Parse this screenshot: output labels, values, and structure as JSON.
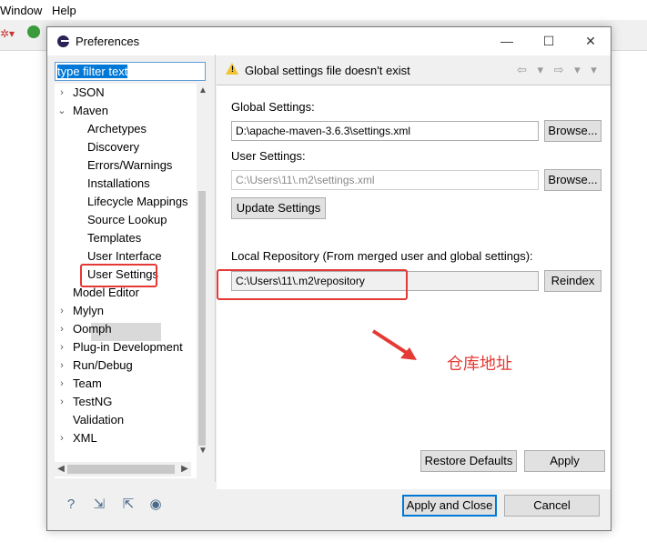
{
  "menubar": {
    "items": [
      "Window",
      "Help"
    ]
  },
  "dialog": {
    "title": "Preferences",
    "window_controls": [
      "—",
      "☐",
      "✕"
    ],
    "filter_text": "type filter text",
    "tree": [
      {
        "label": "JSON",
        "arrow": "›"
      },
      {
        "label": "Maven",
        "arrow": "⌄"
      },
      {
        "label": "Archetypes"
      },
      {
        "label": "Discovery"
      },
      {
        "label": "Errors/Warnings"
      },
      {
        "label": "Installations"
      },
      {
        "label": "Lifecycle Mappings"
      },
      {
        "label": "Source Lookup"
      },
      {
        "label": "Templates"
      },
      {
        "label": "User Interface"
      },
      {
        "label": "User Settings"
      },
      {
        "label": "Model Editor"
      },
      {
        "label": "Mylyn",
        "arrow": "›"
      },
      {
        "label": "Oomph",
        "arrow": "›"
      },
      {
        "label": "Plug-in Development",
        "arrow": "›"
      },
      {
        "label": "Run/Debug",
        "arrow": "›"
      },
      {
        "label": "Team",
        "arrow": "›"
      },
      {
        "label": "TestNG",
        "arrow": "›"
      },
      {
        "label": "Validation"
      },
      {
        "label": "XML",
        "arrow": "›"
      }
    ],
    "header_message": "Global settings file doesn't exist",
    "nav_icons": "⇦ ▾ ⇨ ▾ ▾",
    "global_settings_label": "Global Settings:",
    "global_settings_value": "D:\\apache-maven-3.6.3\\settings.xml",
    "user_settings_label": "User Settings:",
    "user_settings_value": "C:\\Users\\11\\.m2\\settings.xml",
    "browse_label": "Browse...",
    "update_settings_label": "Update Settings",
    "local_repo_label": "Local Repository (From merged user and global settings):",
    "local_repo_value": "C:\\Users\\11\\.m2\\repository",
    "reindex_label": "Reindex",
    "restore_defaults_label": "Restore Defaults",
    "apply_label": "Apply",
    "apply_close_label": "Apply and Close",
    "cancel_label": "Cancel"
  },
  "annotation": {
    "text": "仓库地址",
    "color": "#e53935"
  }
}
